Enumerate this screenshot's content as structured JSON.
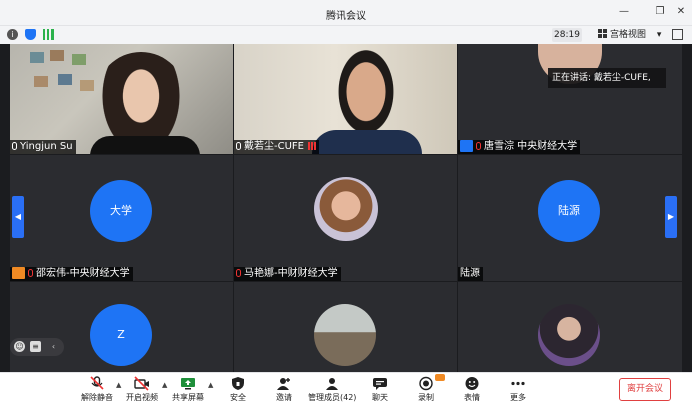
{
  "window": {
    "title": "腾讯会议",
    "controls": [
      "minimize-icon",
      "restore-icon",
      "close-icon"
    ]
  },
  "infobar": {
    "timer": "28:19",
    "view_label": "宫格视图",
    "view_caret": "▾"
  },
  "speaking": {
    "text": "正在讲话: 戴若尘-CUFE,"
  },
  "tiles": [
    {
      "name": "Yingjun Su",
      "type": "video"
    },
    {
      "name": "戴若尘-CUFE",
      "type": "video"
    },
    {
      "name": "唐雪淙 中央财经大学",
      "type": "video"
    },
    {
      "name": "邵宏伟-中央财经大学",
      "type": "avatar",
      "avatar_text": "大学"
    },
    {
      "name": "马艳娜-中财财经大学",
      "type": "photo"
    },
    {
      "name": "陆源",
      "type": "avatar",
      "avatar_text": "陆源"
    },
    {
      "name": "",
      "type": "avatar",
      "avatar_text": "Z"
    },
    {
      "name": "",
      "type": "photo"
    },
    {
      "name": "",
      "type": "photo"
    }
  ],
  "toolbar": {
    "buttons": [
      {
        "label": "解除静音",
        "icon": "mic-muted-icon"
      },
      {
        "label": "开启视频",
        "icon": "camera-off-icon"
      },
      {
        "label": "共享屏幕",
        "icon": "share-screen-icon"
      },
      {
        "label": "安全",
        "icon": "shield-icon"
      },
      {
        "label": "邀请",
        "icon": "add-user-icon"
      },
      {
        "label": "管理成员(42)",
        "icon": "members-icon"
      },
      {
        "label": "聊天",
        "icon": "chat-icon"
      },
      {
        "label": "录制",
        "icon": "record-icon"
      },
      {
        "label": "表情",
        "icon": "emoji-icon"
      },
      {
        "label": "更多",
        "icon": "more-icon"
      }
    ],
    "leave_label": "离开会议"
  },
  "colors": {
    "accent": "#1e74f5",
    "danger": "#e04040",
    "grid_bg": "#1b1c1f",
    "tile_bg": "#2b2c30"
  }
}
